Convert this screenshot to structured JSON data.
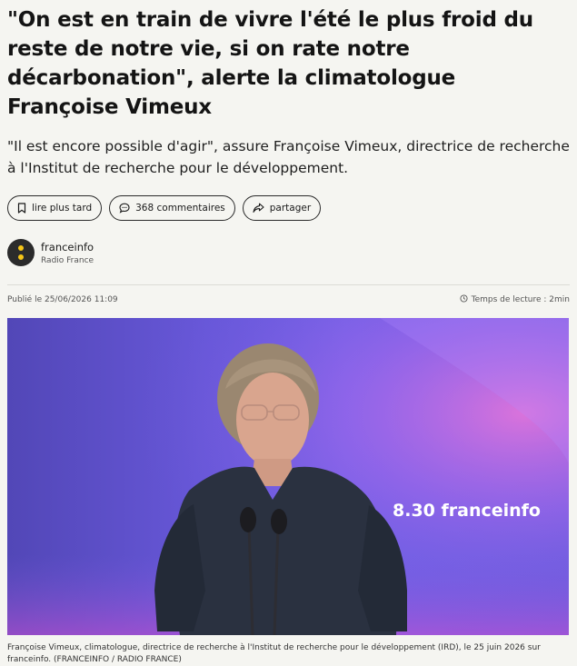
{
  "article": {
    "title": "\"On est en train de vivre l'été le plus froid du reste de notre vie, si on rate notre décarbonation\", alerte la climatologue Françoise Vimeux",
    "lead": "\"Il est encore possible d'agir\", assure Françoise Vimeux, directrice de recherche à l'Institut de recherche pour le développement."
  },
  "actions": {
    "read_later": "lire plus tard",
    "comments": "368 commentaires",
    "share": "partager"
  },
  "author": {
    "name": "franceinfo",
    "org": "Radio France"
  },
  "meta": {
    "published": "Publié le 25/06/2026 11:09",
    "reading_time": "Temps de lecture : 2min"
  },
  "photo": {
    "overlay_text": "8.30 franceinfo",
    "caption": "Françoise Vimeux, climatologue, directrice de recherche à l'Institut de recherche pour le développement (IRD), le 25 juin 2026 sur franceinfo. (FRANCEINFO / RADIO FRANCE)"
  },
  "colors": {
    "background": "#f5f5f1",
    "studio_purple": "#6757d8",
    "accent_yellow": "#f5c518"
  },
  "icons": [
    "bookmark-icon",
    "comment-icon",
    "share-icon",
    "clock-icon",
    "franceinfo-logo"
  ]
}
